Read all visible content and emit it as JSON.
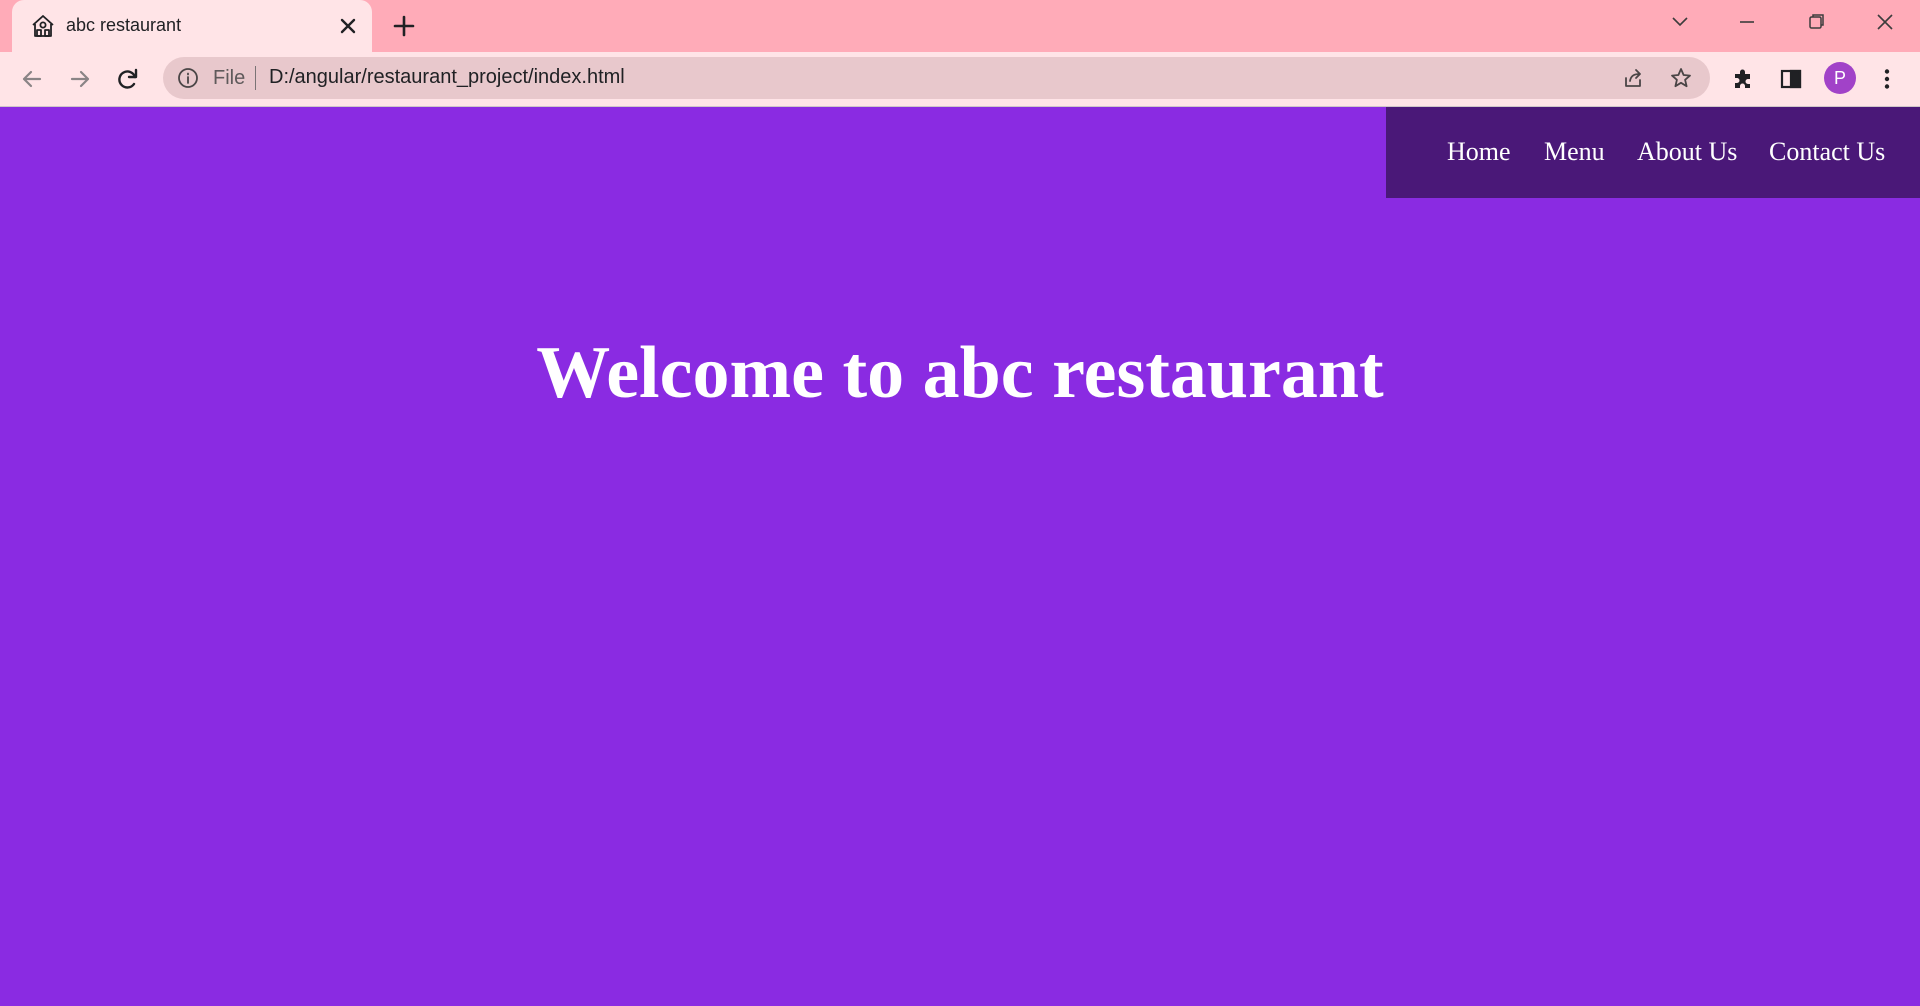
{
  "tab": {
    "title": "abc restaurant",
    "favicon": "restaurant-house-icon"
  },
  "toolbar": {
    "back_icon": "arrow-left-icon",
    "forward_icon": "arrow-right-icon",
    "reload_icon": "reload-icon",
    "omnibox": {
      "info_icon": "info-circle-icon",
      "scheme_label": "File",
      "url": "D:/angular/restaurant_project/index.html",
      "share_icon": "share-icon",
      "bookmark_icon": "star-icon"
    },
    "extensions_icon": "puzzle-icon",
    "side_panel_icon": "side-panel-icon",
    "profile_initial": "P",
    "menu_icon": "kebab-menu-icon"
  },
  "window_controls": {
    "tab_search_icon": "chevron-down-icon",
    "minimize_icon": "minimize-icon",
    "restore_icon": "restore-icon",
    "close_icon": "close-icon"
  },
  "site": {
    "nav": [
      "Home",
      "Menu",
      "About Us",
      "Contact Us"
    ],
    "headline": "Welcome to abc restaurant"
  },
  "colors": {
    "tabstrip": "#ffabb8",
    "toolbar": "#ffe4e7",
    "page_background": "#8a2be2",
    "nav_background": "#4a1878",
    "text": "#ffffff",
    "avatar": "#a142c8"
  }
}
